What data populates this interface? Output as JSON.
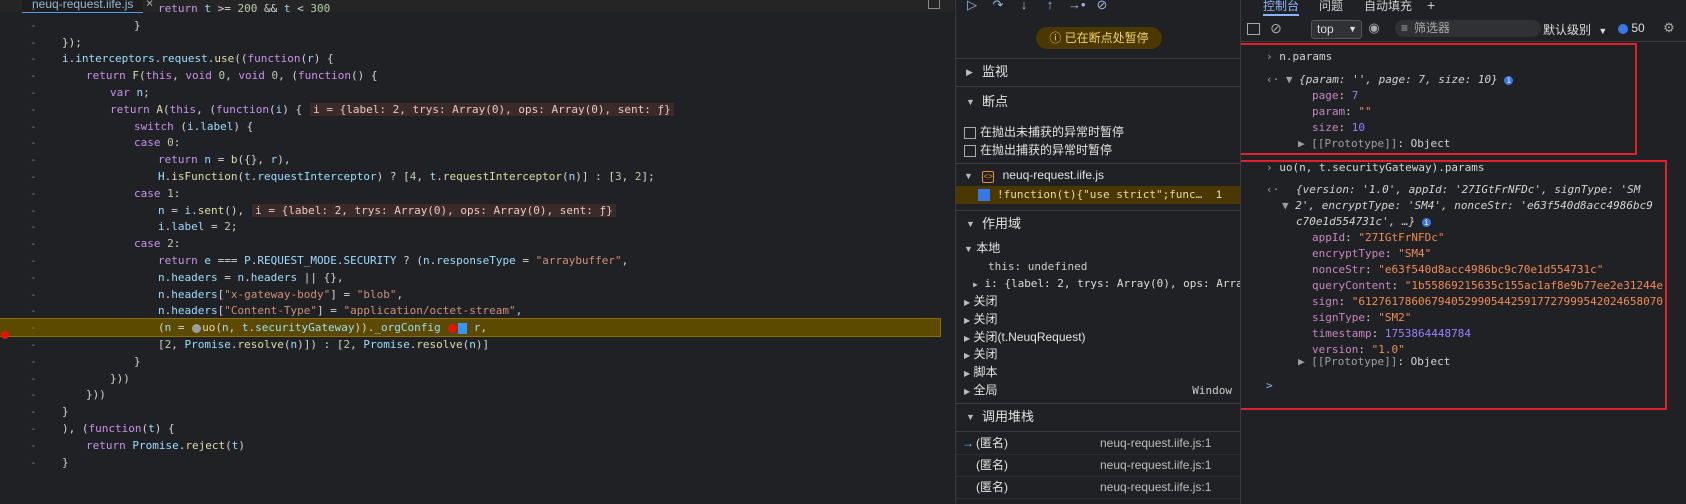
{
  "editor": {
    "file_tab": "neuq-request.iife.js",
    "close_glyph": "×",
    "lines": [
      {
        "indent": 4,
        "text": "return t >= 200 && t < 300"
      },
      {
        "indent": 3,
        "text": "}"
      },
      {
        "indent": 0,
        "text": "});"
      },
      {
        "indent": 0,
        "text": "i.interceptors.request.use((function(r) {"
      },
      {
        "indent": 1,
        "text": "return F(this, void 0, void 0, (function() {"
      },
      {
        "indent": 2,
        "text": "var n;"
      },
      {
        "indent": 2,
        "text": "return A(this, (function(i) {",
        "hint": "i = {label: 2, trys: Array(0), ops: Array(0), sent: ƒ}"
      },
      {
        "indent": 3,
        "text": "switch (i.label) {"
      },
      {
        "indent": 3,
        "text": "case 0:"
      },
      {
        "indent": 4,
        "text": "return n = b({}, r),"
      },
      {
        "indent": 4,
        "text": "H.isFunction(t.requestInterceptor) ? [4, t.requestInterceptor(n)] : [3, 2];"
      },
      {
        "indent": 3,
        "text": "case 1:"
      },
      {
        "indent": 4,
        "text": "n = i.sent(),",
        "hint": "i = {label: 2, trys: Array(0), ops: Array(0), sent: ƒ}"
      },
      {
        "indent": 4,
        "text": "i.label = 2;"
      },
      {
        "indent": 3,
        "text": "case 2:"
      },
      {
        "indent": 4,
        "text": "return e === P.REQUEST_MODE.SECURITY ? (n.responseType = \"arraybuffer\","
      },
      {
        "indent": 4,
        "text": "n.headers = n.headers || {},"
      },
      {
        "indent": 4,
        "text": "n.headers[\"x-gateway-body\"] = \"blob\","
      },
      {
        "indent": 4,
        "text": "n.headers[\"Content-Type\"] = \"application/octet-stream\","
      },
      {
        "indent": 4,
        "text": "(n = ",
        "paused": true,
        "after_dot": "uo(n, t.securityGateway))._orgConfig ",
        "after_bp": " r,"
      },
      {
        "indent": 4,
        "text": "[2, Promise.resolve(n)]) : [2, Promise.resolve(n)]"
      },
      {
        "indent": 3,
        "text": "}"
      },
      {
        "indent": 2,
        "text": "}))"
      },
      {
        "indent": 1,
        "text": "}))"
      },
      {
        "indent": 0,
        "text": "}"
      },
      {
        "indent": 0,
        "text": "), (function(t) {"
      },
      {
        "indent": 1,
        "text": "return Promise.reject(t)"
      },
      {
        "indent": 0,
        "text": "}"
      }
    ],
    "gutter_mark": "-"
  },
  "debugger": {
    "toolbar_icons": [
      "resume-icon",
      "step-over-icon",
      "step-into-icon",
      "step-out-icon",
      "step-icon",
      "deactivate-breakpoints-icon"
    ],
    "toolbar_glyphs": [
      "▷",
      "↷",
      "↓",
      "↑",
      "→•",
      "⊘"
    ],
    "paused_banner": "已在断点处暂停",
    "paused_icon": "ⓘ",
    "watch_label": "监视",
    "breakpoints_label": "断点",
    "pause_uncaught": "在抛出未捕获的异常时暂停",
    "pause_caught": "在抛出捕获的异常时暂停",
    "bp_file": "neuq-request.iife.js",
    "bp_code": "!function(t){\"use strict\";func…",
    "bp_line": "1",
    "scope_label": "作用域",
    "scope_local": "本地",
    "scope_this": "this: undefined",
    "scope_i": "i: {label: 2, trys: Array(0), ops: Arra",
    "closures": [
      "关闭",
      "关闭",
      "关闭(t.NeuqRequest)",
      "关闭"
    ],
    "script_label": "脚本",
    "global_label": "全局",
    "global_value": "Window",
    "callstack_label": "调用堆栈",
    "callstack": [
      {
        "name": "(匿名)",
        "location": "neuq-request.iife.js:1",
        "current": true
      },
      {
        "name": "(匿名)",
        "location": "neuq-request.iife.js:1",
        "current": false
      },
      {
        "name": "(匿名)",
        "location": "neuq-request.iife.js:1",
        "current": false
      }
    ]
  },
  "console": {
    "tabs": [
      "控制台",
      "问题",
      "自动填充"
    ],
    "add_tab": "+",
    "context": "top",
    "filter_placeholder": "筛选器",
    "level": "默认级别",
    "issues_count": "50",
    "entry1": {
      "input": "n.params",
      "summary": "{param: '', page: 7, size: 10}",
      "props": [
        {
          "key": "page",
          "value": "7",
          "kind": "num"
        },
        {
          "key": "param",
          "value": "\"\"",
          "kind": "str"
        },
        {
          "key": "size",
          "value": "10",
          "kind": "num"
        }
      ],
      "proto": "[[Prototype]]",
      "proto_value": "Object"
    },
    "entry2": {
      "input": "uo(n, t.securityGateway).params",
      "summary_line1": "{version: '1.0', appId: '27IGtFrNFDc', signType: 'SM",
      "summary_line2": "2', encryptType: 'SM4', nonceStr: 'e63f540d8acc4986bc9",
      "summary_line3": "c70e1d554731c', …}",
      "props": [
        {
          "key": "appId",
          "value": "\"27IGtFrNFDc\"",
          "kind": "str"
        },
        {
          "key": "encryptType",
          "value": "\"SM4\"",
          "kind": "str"
        },
        {
          "key": "nonceStr",
          "value": "\"e63f540d8acc4986bc9c70e1d554731c\"",
          "kind": "str"
        },
        {
          "key": "queryContent",
          "value": "\"1b55869215635c155ac1af8e9b77ee2e31244e",
          "kind": "str"
        },
        {
          "key": "sign",
          "value": "\"6127617860679405299054425917727999542024658070",
          "kind": "str"
        },
        {
          "key": "signType",
          "value": "\"SM2\"",
          "kind": "str"
        },
        {
          "key": "timestamp",
          "value": "1753864448784",
          "kind": "num"
        },
        {
          "key": "version",
          "value": "\"1.0\"",
          "kind": "str"
        }
      ],
      "proto": "[[Prototype]]",
      "proto_value": "Object"
    },
    "prompt": ">"
  }
}
